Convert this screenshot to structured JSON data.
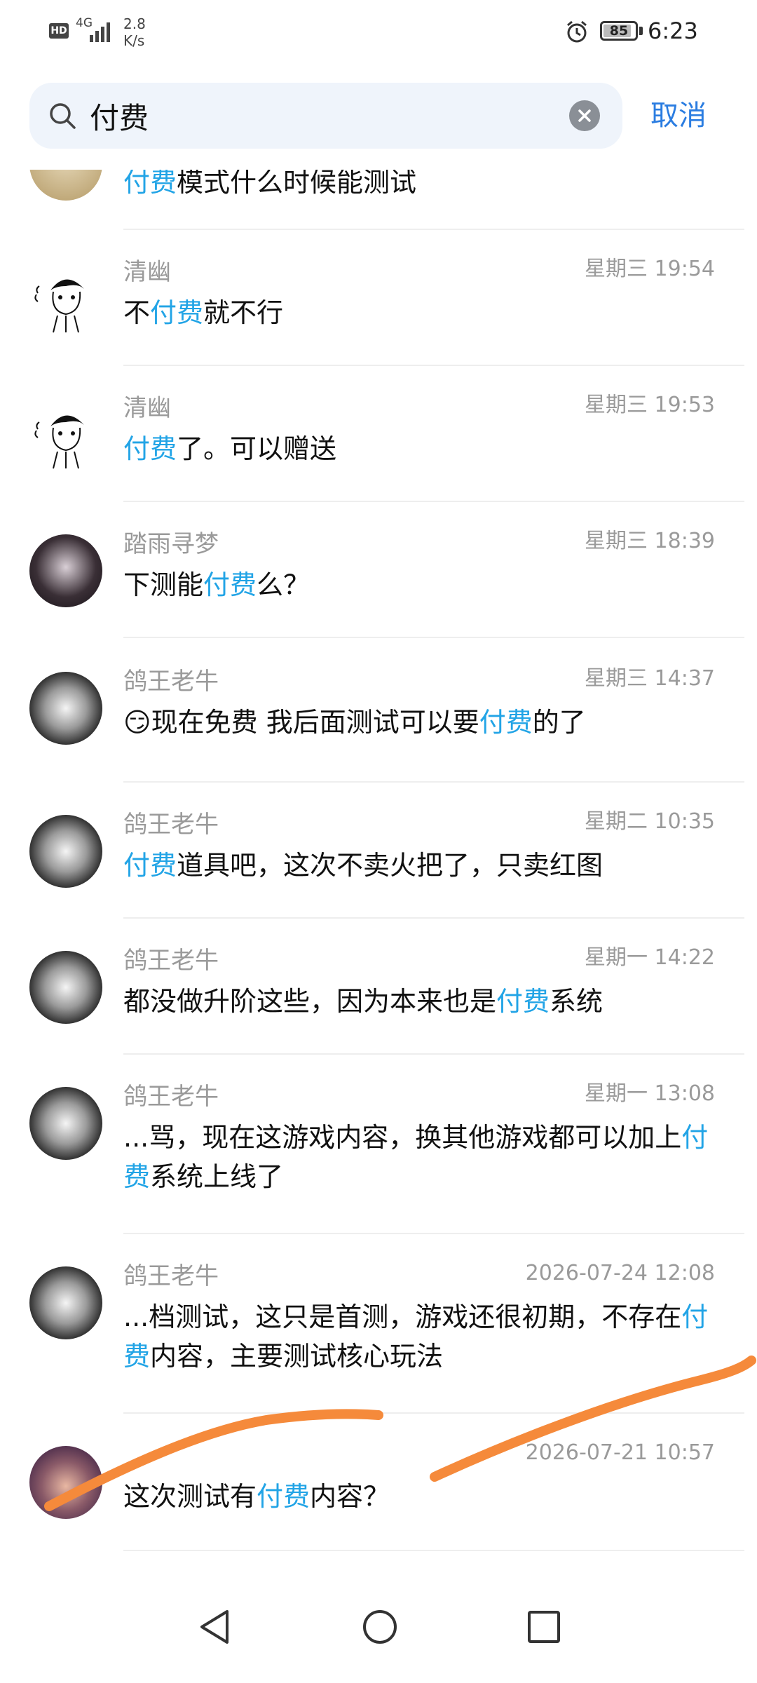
{
  "status_bar": {
    "hd_label": "HD",
    "network": "4G",
    "speed_value": "2.8",
    "speed_unit": "K/s",
    "battery": "85",
    "time": "6:23"
  },
  "search": {
    "query": "付费",
    "cancel_label": "取消"
  },
  "results": [
    {
      "id": "r0",
      "name": "",
      "time": "",
      "parts": [
        {
          "t": "付费",
          "hl": true
        },
        {
          "t": "模式什么时候能测试",
          "hl": false
        }
      ]
    },
    {
      "id": "r1",
      "name": "清幽",
      "time": "星期三 19:54",
      "parts": [
        {
          "t": "不",
          "hl": false
        },
        {
          "t": "付费",
          "hl": true
        },
        {
          "t": "就不行",
          "hl": false
        }
      ]
    },
    {
      "id": "r2",
      "name": "清幽",
      "time": "星期三 19:53",
      "parts": [
        {
          "t": "付费",
          "hl": true
        },
        {
          "t": "了。可以赠送",
          "hl": false
        }
      ]
    },
    {
      "id": "r3",
      "name": "踏雨寻梦",
      "time": "星期三 18:39",
      "parts": [
        {
          "t": "下测能",
          "hl": false
        },
        {
          "t": "付费",
          "hl": true
        },
        {
          "t": "么？",
          "hl": false
        }
      ]
    },
    {
      "id": "r4",
      "name": "鸽王老牛",
      "time": "星期三 14:37",
      "emoji": "😏",
      "parts": [
        {
          "t": "现在免费  我后面测试可以要",
          "hl": false
        },
        {
          "t": "付费",
          "hl": true
        },
        {
          "t": "的了",
          "hl": false
        }
      ]
    },
    {
      "id": "r5",
      "name": "鸽王老牛",
      "time": "星期二 10:35",
      "parts": [
        {
          "t": "付费",
          "hl": true
        },
        {
          "t": "道具吧，这次不卖火把了，只卖红图",
          "hl": false
        }
      ]
    },
    {
      "id": "r6",
      "name": "鸽王老牛",
      "time": "星期一 14:22",
      "parts": [
        {
          "t": "都没做升阶这些，因为本来也是",
          "hl": false
        },
        {
          "t": "付费",
          "hl": true
        },
        {
          "t": "系统",
          "hl": false
        }
      ]
    },
    {
      "id": "r7",
      "name": "鸽王老牛",
      "time": "星期一 13:08",
      "parts": [
        {
          "t": "...骂，现在这游戏内容，换其他游戏都可以加上",
          "hl": false
        },
        {
          "t": "付费",
          "hl": true
        },
        {
          "t": "系统上线了",
          "hl": false
        }
      ]
    },
    {
      "id": "r8",
      "name": "鸽王老牛",
      "time": "2026-07-24 12:08",
      "parts": [
        {
          "t": "...档测试，这只是首测，游戏还很初期，不存在",
          "hl": false
        },
        {
          "t": "付费",
          "hl": true
        },
        {
          "t": "内容，主要测试核心玩法",
          "hl": false
        }
      ]
    },
    {
      "id": "r9",
      "name": "",
      "time": "2026-07-21 10:57",
      "parts": [
        {
          "t": "这次测试有",
          "hl": false
        },
        {
          "t": "付费",
          "hl": true
        },
        {
          "t": "内容？",
          "hl": false
        }
      ]
    }
  ],
  "colors": {
    "highlight": "#22a4e6",
    "cancel": "#2b7de1",
    "annotation_stroke": "#f58a3b"
  },
  "nav_icons": [
    "back-triangle-icon",
    "home-circle-icon",
    "recents-square-icon"
  ]
}
